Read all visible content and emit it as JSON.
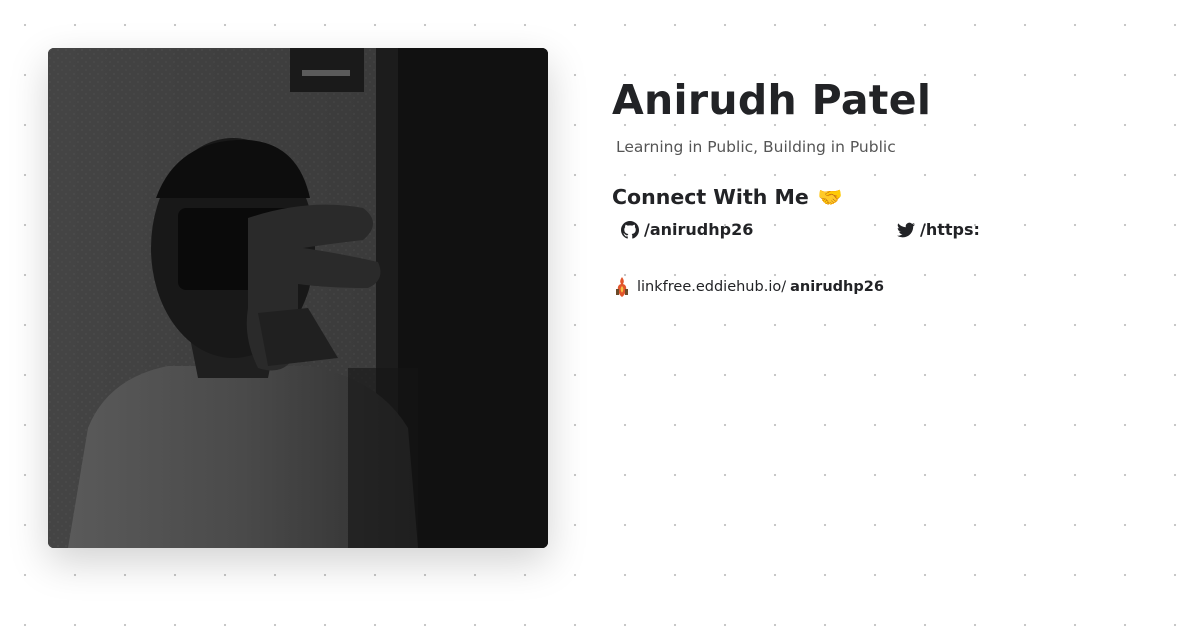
{
  "profile": {
    "name": "Anirudh Patel",
    "tagline": "Learning in Public, Building in Public",
    "photo_icon": "profile-photo"
  },
  "connect": {
    "heading": "Connect With Me",
    "heading_emoji": "🤝",
    "socials": [
      {
        "icon": "github-icon",
        "label": "/anirudhp26"
      },
      {
        "icon": "twitter-icon",
        "label": "/https:"
      }
    ]
  },
  "linkfree": {
    "icon": "linkfree-icon",
    "domain": "linkfree.eddiehub.io/",
    "username": "anirudhp26"
  }
}
